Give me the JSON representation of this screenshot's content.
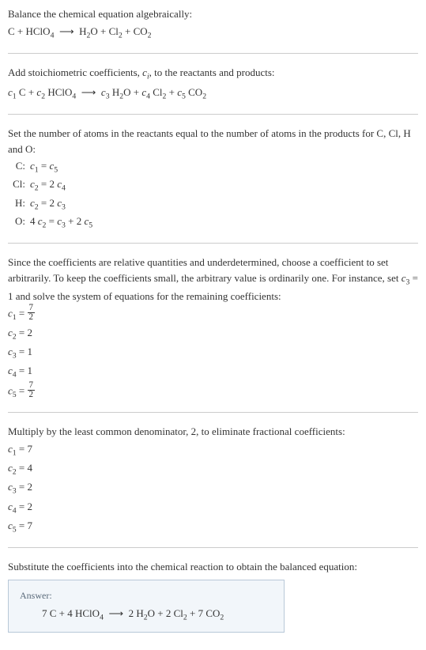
{
  "intro": {
    "title": "Balance the chemical equation algebraically:",
    "equation": "C + HClO₄ ⟶ H₂O + Cl₂ + CO₂"
  },
  "stoich": {
    "title_part1": "Add stoichiometric coefficients, ",
    "title_var": "cᵢ",
    "title_part2": ", to the reactants and products:",
    "equation": "c₁ C + c₂ HClO₄ ⟶ c₃ H₂O + c₄ Cl₂ + c₅ CO₂"
  },
  "atoms": {
    "title": "Set the number of atoms in the reactants equal to the number of atoms in the products for C, Cl, H and O:",
    "rows": [
      {
        "label": "C:",
        "eq": "c₁ = c₅"
      },
      {
        "label": "Cl:",
        "eq": "c₂ = 2 c₄"
      },
      {
        "label": "H:",
        "eq": "c₂ = 2 c₃"
      },
      {
        "label": "O:",
        "eq": "4 c₂ = c₃ + 2 c₅"
      }
    ]
  },
  "solve": {
    "title": "Since the coefficients are relative quantities and underdetermined, choose a coefficient to set arbitrarily. To keep the coefficients small, the arbitrary value is ordinarily one. For instance, set c₃ = 1 and solve the system of equations for the remaining coefficients:",
    "c1_lhs": "c₁ = ",
    "c1_num": "7",
    "c1_den": "2",
    "c2": "c₂ = 2",
    "c3": "c₃ = 1",
    "c4": "c₄ = 1",
    "c5_lhs": "c₅ = ",
    "c5_num": "7",
    "c5_den": "2"
  },
  "lcd": {
    "title": "Multiply by the least common denominator, 2, to eliminate fractional coefficients:",
    "rows": [
      "c₁ = 7",
      "c₂ = 4",
      "c₃ = 2",
      "c₄ = 2",
      "c₅ = 7"
    ]
  },
  "final": {
    "title": "Substitute the coefficients into the chemical reaction to obtain the balanced equation:",
    "answer_label": "Answer:",
    "answer_eq": "7 C + 4 HClO₄ ⟶ 2 H₂O + 2 Cl₂ + 7 CO₂"
  }
}
